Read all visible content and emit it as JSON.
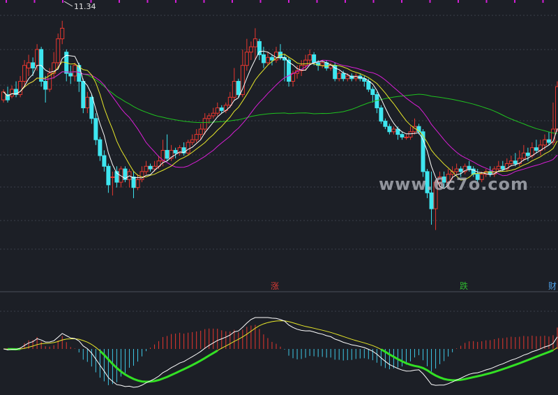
{
  "chart_data": [
    {
      "type": "candlestick",
      "title": "",
      "high_label": "11.34",
      "x": [
        0,
        1,
        2,
        3,
        4,
        5,
        6,
        7,
        8,
        9,
        10,
        11,
        12,
        13,
        14,
        15,
        16,
        17,
        18,
        19,
        20,
        21,
        22,
        23,
        24,
        25,
        26,
        27,
        28,
        29,
        30,
        31,
        32,
        33,
        34,
        35,
        36,
        37,
        38,
        39,
        40,
        41,
        42,
        43,
        44,
        45,
        46,
        47,
        48,
        49,
        50,
        51,
        52,
        53,
        54,
        55,
        56,
        57,
        58,
        59,
        60,
        61,
        62,
        63,
        64,
        65,
        66,
        67,
        68,
        69,
        70,
        71,
        72,
        73,
        74,
        75,
        76,
        77,
        78,
        79,
        80,
        81,
        82,
        83,
        84,
        85,
        86,
        87,
        88,
        89,
        90,
        91,
        92,
        93,
        94,
        95,
        96,
        97,
        98,
        99,
        100,
        101,
        102,
        103,
        104,
        105,
        106,
        107,
        108,
        109,
        110,
        111,
        112,
        113,
        114,
        115,
        116,
        117,
        118,
        119,
        120,
        121,
        122,
        123,
        124,
        125,
        126,
        127,
        128,
        129,
        130,
        131,
        132
      ],
      "candles": [
        [
          9.85,
          10.0,
          9.8,
          10.05
        ],
        [
          9.95,
          9.85,
          9.8,
          10.1
        ],
        [
          9.92,
          10.05,
          9.88,
          10.12
        ],
        [
          10.05,
          9.95,
          9.9,
          10.2
        ],
        [
          9.95,
          10.2,
          9.9,
          10.3
        ],
        [
          10.2,
          10.5,
          10.1,
          10.6
        ],
        [
          10.45,
          10.55,
          10.3,
          10.7
        ],
        [
          10.55,
          10.45,
          10.3,
          10.65
        ],
        [
          10.5,
          10.8,
          10.4,
          10.9
        ],
        [
          10.8,
          10.2,
          10.1,
          10.85
        ],
        [
          10.2,
          10.05,
          9.8,
          10.3
        ],
        [
          10.05,
          10.35,
          10.0,
          10.45
        ],
        [
          10.35,
          10.55,
          10.25,
          10.75
        ],
        [
          10.55,
          11.0,
          10.45,
          11.1
        ],
        [
          11.0,
          11.2,
          10.9,
          11.34
        ],
        [
          10.75,
          10.35,
          10.2,
          10.8
        ],
        [
          10.35,
          10.3,
          10.15,
          10.5
        ],
        [
          10.3,
          10.5,
          10.2,
          10.55
        ],
        [
          10.5,
          10.2,
          10.0,
          10.55
        ],
        [
          10.2,
          9.7,
          9.6,
          10.25
        ],
        [
          9.7,
          9.9,
          9.6,
          10.0
        ],
        [
          9.9,
          9.5,
          9.4,
          9.95
        ],
        [
          9.5,
          9.1,
          9.0,
          9.6
        ],
        [
          9.1,
          8.8,
          8.7,
          9.15
        ],
        [
          8.8,
          8.6,
          8.5,
          8.9
        ],
        [
          8.6,
          8.25,
          8.1,
          8.65
        ],
        [
          8.4,
          8.4,
          8.05,
          8.5
        ],
        [
          8.5,
          8.3,
          8.2,
          8.6
        ],
        [
          8.3,
          8.55,
          8.2,
          8.6
        ],
        [
          8.55,
          8.35,
          8.3,
          8.6
        ],
        [
          8.35,
          8.5,
          8.2,
          8.55
        ],
        [
          8.4,
          8.2,
          8.0,
          8.5
        ],
        [
          8.2,
          8.35,
          8.15,
          8.45
        ],
        [
          8.35,
          8.5,
          8.3,
          8.6
        ],
        [
          8.5,
          8.6,
          8.45,
          8.7
        ],
        [
          8.6,
          8.55,
          8.5,
          8.65
        ],
        [
          8.55,
          8.6,
          8.5,
          8.7
        ],
        [
          8.6,
          8.7,
          8.55,
          8.8
        ],
        [
          8.7,
          8.9,
          8.6,
          9.1
        ],
        [
          8.9,
          8.75,
          8.7,
          9.2
        ],
        [
          8.75,
          8.9,
          8.7,
          9.0
        ],
        [
          8.9,
          8.85,
          8.75,
          8.95
        ],
        [
          8.85,
          8.95,
          8.8,
          9.0
        ],
        [
          8.95,
          8.85,
          8.8,
          9.05
        ],
        [
          8.85,
          9.05,
          8.8,
          9.1
        ],
        [
          9.05,
          9.1,
          9.0,
          9.2
        ],
        [
          9.1,
          9.2,
          9.05,
          9.3
        ],
        [
          9.2,
          9.3,
          9.1,
          9.4
        ],
        [
          9.3,
          9.5,
          9.2,
          9.6
        ],
        [
          9.5,
          9.55,
          9.4,
          9.6
        ],
        [
          9.55,
          9.6,
          9.5,
          9.7
        ],
        [
          9.6,
          9.7,
          9.55,
          9.8
        ],
        [
          9.7,
          9.65,
          9.6,
          9.75
        ],
        [
          9.65,
          9.75,
          9.6,
          9.8
        ],
        [
          9.75,
          9.9,
          9.7,
          10.0
        ],
        [
          9.9,
          10.2,
          9.85,
          10.45
        ],
        [
          10.2,
          9.95,
          9.9,
          10.25
        ],
        [
          9.95,
          10.5,
          9.9,
          10.8
        ],
        [
          10.5,
          10.75,
          10.4,
          11.0
        ],
        [
          10.75,
          10.85,
          10.6,
          10.95
        ],
        [
          10.85,
          11.0,
          10.6,
          11.2
        ],
        [
          10.95,
          10.7,
          10.6,
          11.0
        ],
        [
          10.7,
          10.55,
          10.45,
          10.85
        ],
        [
          10.55,
          10.65,
          10.5,
          10.75
        ],
        [
          10.65,
          10.6,
          10.5,
          10.7
        ],
        [
          10.6,
          10.75,
          10.55,
          10.85
        ],
        [
          10.75,
          10.65,
          10.6,
          10.9
        ],
        [
          10.65,
          10.6,
          10.2,
          10.7
        ],
        [
          10.6,
          10.2,
          10.1,
          10.65
        ],
        [
          10.2,
          10.35,
          10.1,
          10.4
        ],
        [
          10.35,
          10.4,
          10.25,
          10.5
        ],
        [
          10.4,
          10.5,
          10.3,
          10.6
        ],
        [
          10.5,
          10.6,
          10.4,
          10.7
        ],
        [
          10.6,
          10.7,
          10.5,
          10.8
        ],
        [
          10.7,
          10.55,
          10.5,
          10.75
        ],
        [
          10.55,
          10.5,
          10.4,
          10.6
        ],
        [
          10.5,
          10.55,
          10.45,
          10.6
        ],
        [
          10.55,
          10.45,
          10.4,
          10.6
        ],
        [
          10.45,
          10.5,
          10.4,
          10.55
        ],
        [
          10.5,
          10.25,
          10.2,
          10.55
        ],
        [
          10.25,
          10.35,
          10.2,
          10.4
        ],
        [
          10.35,
          10.25,
          10.2,
          10.4
        ],
        [
          10.25,
          10.3,
          10.2,
          10.35
        ],
        [
          10.3,
          10.25,
          10.2,
          10.35
        ],
        [
          10.25,
          10.3,
          10.2,
          10.35
        ],
        [
          10.3,
          10.25,
          10.2,
          10.35
        ],
        [
          10.25,
          10.2,
          10.1,
          10.3
        ],
        [
          10.2,
          10.05,
          10.0,
          10.25
        ],
        [
          10.05,
          9.95,
          9.8,
          10.1
        ],
        [
          9.95,
          9.7,
          9.6,
          10.0
        ],
        [
          9.7,
          9.45,
          9.4,
          9.75
        ],
        [
          9.45,
          9.35,
          9.3,
          9.5
        ],
        [
          9.35,
          9.25,
          9.2,
          9.4
        ],
        [
          9.25,
          9.3,
          9.2,
          9.35
        ],
        [
          9.3,
          9.2,
          9.1,
          9.35
        ],
        [
          9.2,
          9.15,
          9.1,
          9.25
        ],
        [
          9.15,
          9.15,
          9.1,
          9.2
        ],
        [
          9.15,
          9.25,
          9.1,
          9.35
        ],
        [
          9.25,
          9.35,
          9.2,
          9.5
        ],
        [
          9.35,
          9.25,
          9.2,
          9.4
        ],
        [
          9.25,
          8.5,
          8.4,
          9.3
        ],
        [
          8.5,
          8.1,
          8.0,
          8.55
        ],
        [
          8.1,
          7.8,
          7.5,
          8.5
        ],
        [
          7.8,
          8.3,
          7.4,
          8.35
        ],
        [
          8.3,
          8.4,
          8.2,
          8.5
        ],
        [
          8.4,
          8.3,
          8.2,
          8.5
        ],
        [
          8.3,
          8.45,
          8.2,
          8.55
        ],
        [
          8.45,
          8.5,
          8.35,
          8.6
        ],
        [
          8.5,
          8.55,
          8.45,
          8.65
        ],
        [
          8.55,
          8.5,
          8.4,
          8.6
        ],
        [
          8.5,
          8.6,
          8.45,
          8.65
        ],
        [
          8.6,
          8.55,
          8.5,
          8.7
        ],
        [
          8.55,
          8.45,
          8.4,
          8.6
        ],
        [
          8.45,
          8.35,
          8.3,
          8.55
        ],
        [
          8.35,
          8.45,
          8.3,
          8.5
        ],
        [
          8.45,
          8.5,
          8.4,
          8.55
        ],
        [
          8.5,
          8.45,
          8.4,
          8.6
        ],
        [
          8.45,
          8.55,
          8.4,
          8.6
        ],
        [
          8.55,
          8.6,
          8.5,
          8.7
        ],
        [
          8.6,
          8.55,
          8.5,
          8.7
        ],
        [
          8.55,
          8.65,
          8.5,
          8.75
        ],
        [
          8.65,
          8.7,
          8.6,
          8.8
        ],
        [
          8.7,
          8.65,
          8.6,
          8.85
        ],
        [
          8.65,
          8.75,
          8.6,
          8.9
        ],
        [
          8.75,
          8.85,
          8.7,
          9.0
        ],
        [
          8.85,
          8.8,
          8.7,
          8.95
        ],
        [
          8.8,
          8.95,
          8.75,
          9.05
        ],
        [
          8.95,
          8.9,
          8.85,
          9.1
        ],
        [
          8.9,
          9.0,
          8.8,
          9.1
        ],
        [
          9.0,
          9.1,
          8.9,
          9.2
        ],
        [
          9.1,
          9.05,
          9.0,
          9.25
        ],
        [
          9.05,
          9.3,
          9.0,
          9.8
        ],
        [
          9.3,
          10.1,
          9.25,
          10.2
        ]
      ],
      "ma_colors": {
        "ma5": "#ffffff",
        "ma10": "#e8e82a",
        "ma20": "#d91fd6",
        "ma60": "#1fc21f"
      },
      "ylim": [
        7.0,
        11.6
      ],
      "grid": true
    },
    {
      "type": "macd",
      "ylim": [
        -1.0,
        1.0
      ],
      "colors": {
        "dif": "#ffffff",
        "dea": "#e8e82a",
        "up": "#e8372f",
        "down": "#3ec8e6",
        "highlight": "#33e024"
      }
    }
  ],
  "markers": [
    {
      "label": "涨",
      "color": "#d43a34"
    },
    {
      "label": "跌",
      "color": "#2fb52f"
    },
    {
      "label": "财",
      "color": "#4fa2e8"
    }
  ],
  "watermark": "www.6c7o.com",
  "top_ticks_color": "#d21fd6"
}
